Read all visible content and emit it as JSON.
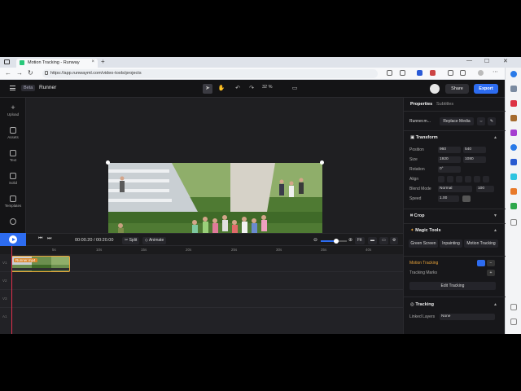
{
  "browser": {
    "tab_title": "Motion Tracking - Runway",
    "tab_close": "×",
    "new_tab": "+",
    "url": "https://app.runwayml.com/video-tools/projects",
    "win_min": "—",
    "win_max": "☐",
    "win_close": "✕"
  },
  "header": {
    "beta": "Beta",
    "project_name": "Runner",
    "zoom": "32 %",
    "share": "Share",
    "export": "Export"
  },
  "rail": {
    "items": [
      {
        "label": "Upload"
      },
      {
        "label": "Assets"
      },
      {
        "label": "Text"
      },
      {
        "label": "Solid"
      },
      {
        "label": "Templates"
      }
    ]
  },
  "timeline": {
    "current_time": "00:00.20",
    "separator": "/",
    "total_time": "00:20.00",
    "split": "Split",
    "animate": "Animate",
    "fit": "Fit",
    "ticks": [
      "5s",
      "10s",
      "15s",
      "20s",
      "25s",
      "30s",
      "35s",
      "40s"
    ],
    "clip_label": "Runner.mp4",
    "track_labels": [
      "V1",
      "V2",
      "V3",
      "A1"
    ]
  },
  "panel": {
    "tab_properties": "Properties",
    "tab_subtitles": "Subtitles",
    "media_name": "Runner.m...",
    "replace_media": "Replace Media",
    "transform": {
      "title": "Transform",
      "position_label": "Position",
      "position_x": "960",
      "position_y": "540",
      "size_label": "Size",
      "size_w": "1920",
      "size_h": "1080",
      "rotation_label": "Rotation",
      "rotation": "0°",
      "align_label": "Align",
      "blend_label": "Blend Mode",
      "blend_value": "Normal",
      "opacity": "100",
      "speed_label": "Speed",
      "speed_value": "1.00"
    },
    "crop": "Crop",
    "magic_tools": {
      "title": "Magic Tools",
      "green_screen": "Green Screen",
      "inpainting": "Inpainting",
      "motion_tracking": "Motion Tracking"
    },
    "motion_tracking": {
      "title": "Motion Tracking",
      "tracking_marks": "Tracking Marks",
      "edit_tracking": "Edit Tracking"
    },
    "tracking": {
      "title": "Tracking",
      "linked_layers": "Linked Layers",
      "linked_value": "None"
    }
  },
  "colors": {
    "accent": "#2d6cf0",
    "clip_border": "#e8a33a",
    "playhead": "#e0304c",
    "magic": "#e8a33a"
  }
}
